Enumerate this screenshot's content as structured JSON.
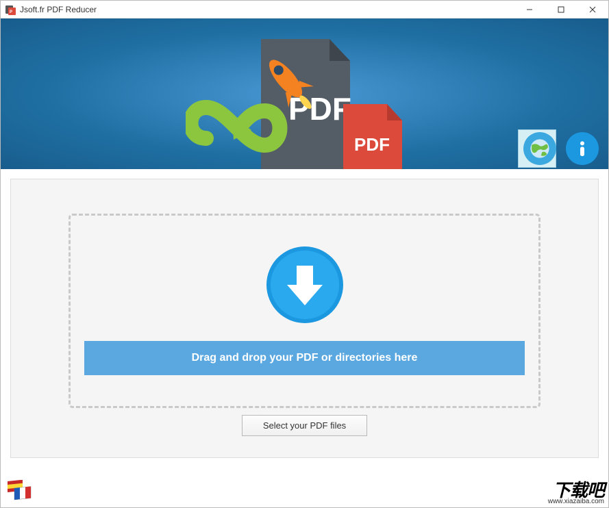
{
  "window": {
    "title": "Jsoft.fr PDF Reducer"
  },
  "dropzone": {
    "instruction": "Drag and drop your PDF or directories here"
  },
  "buttons": {
    "select_files": "Select your PDF files"
  },
  "banner": {
    "pdf_label_back": "PDF",
    "pdf_label_front": "PDF"
  },
  "watermark": {
    "main": "下载吧",
    "sub": "www.xiazaiba.com"
  }
}
